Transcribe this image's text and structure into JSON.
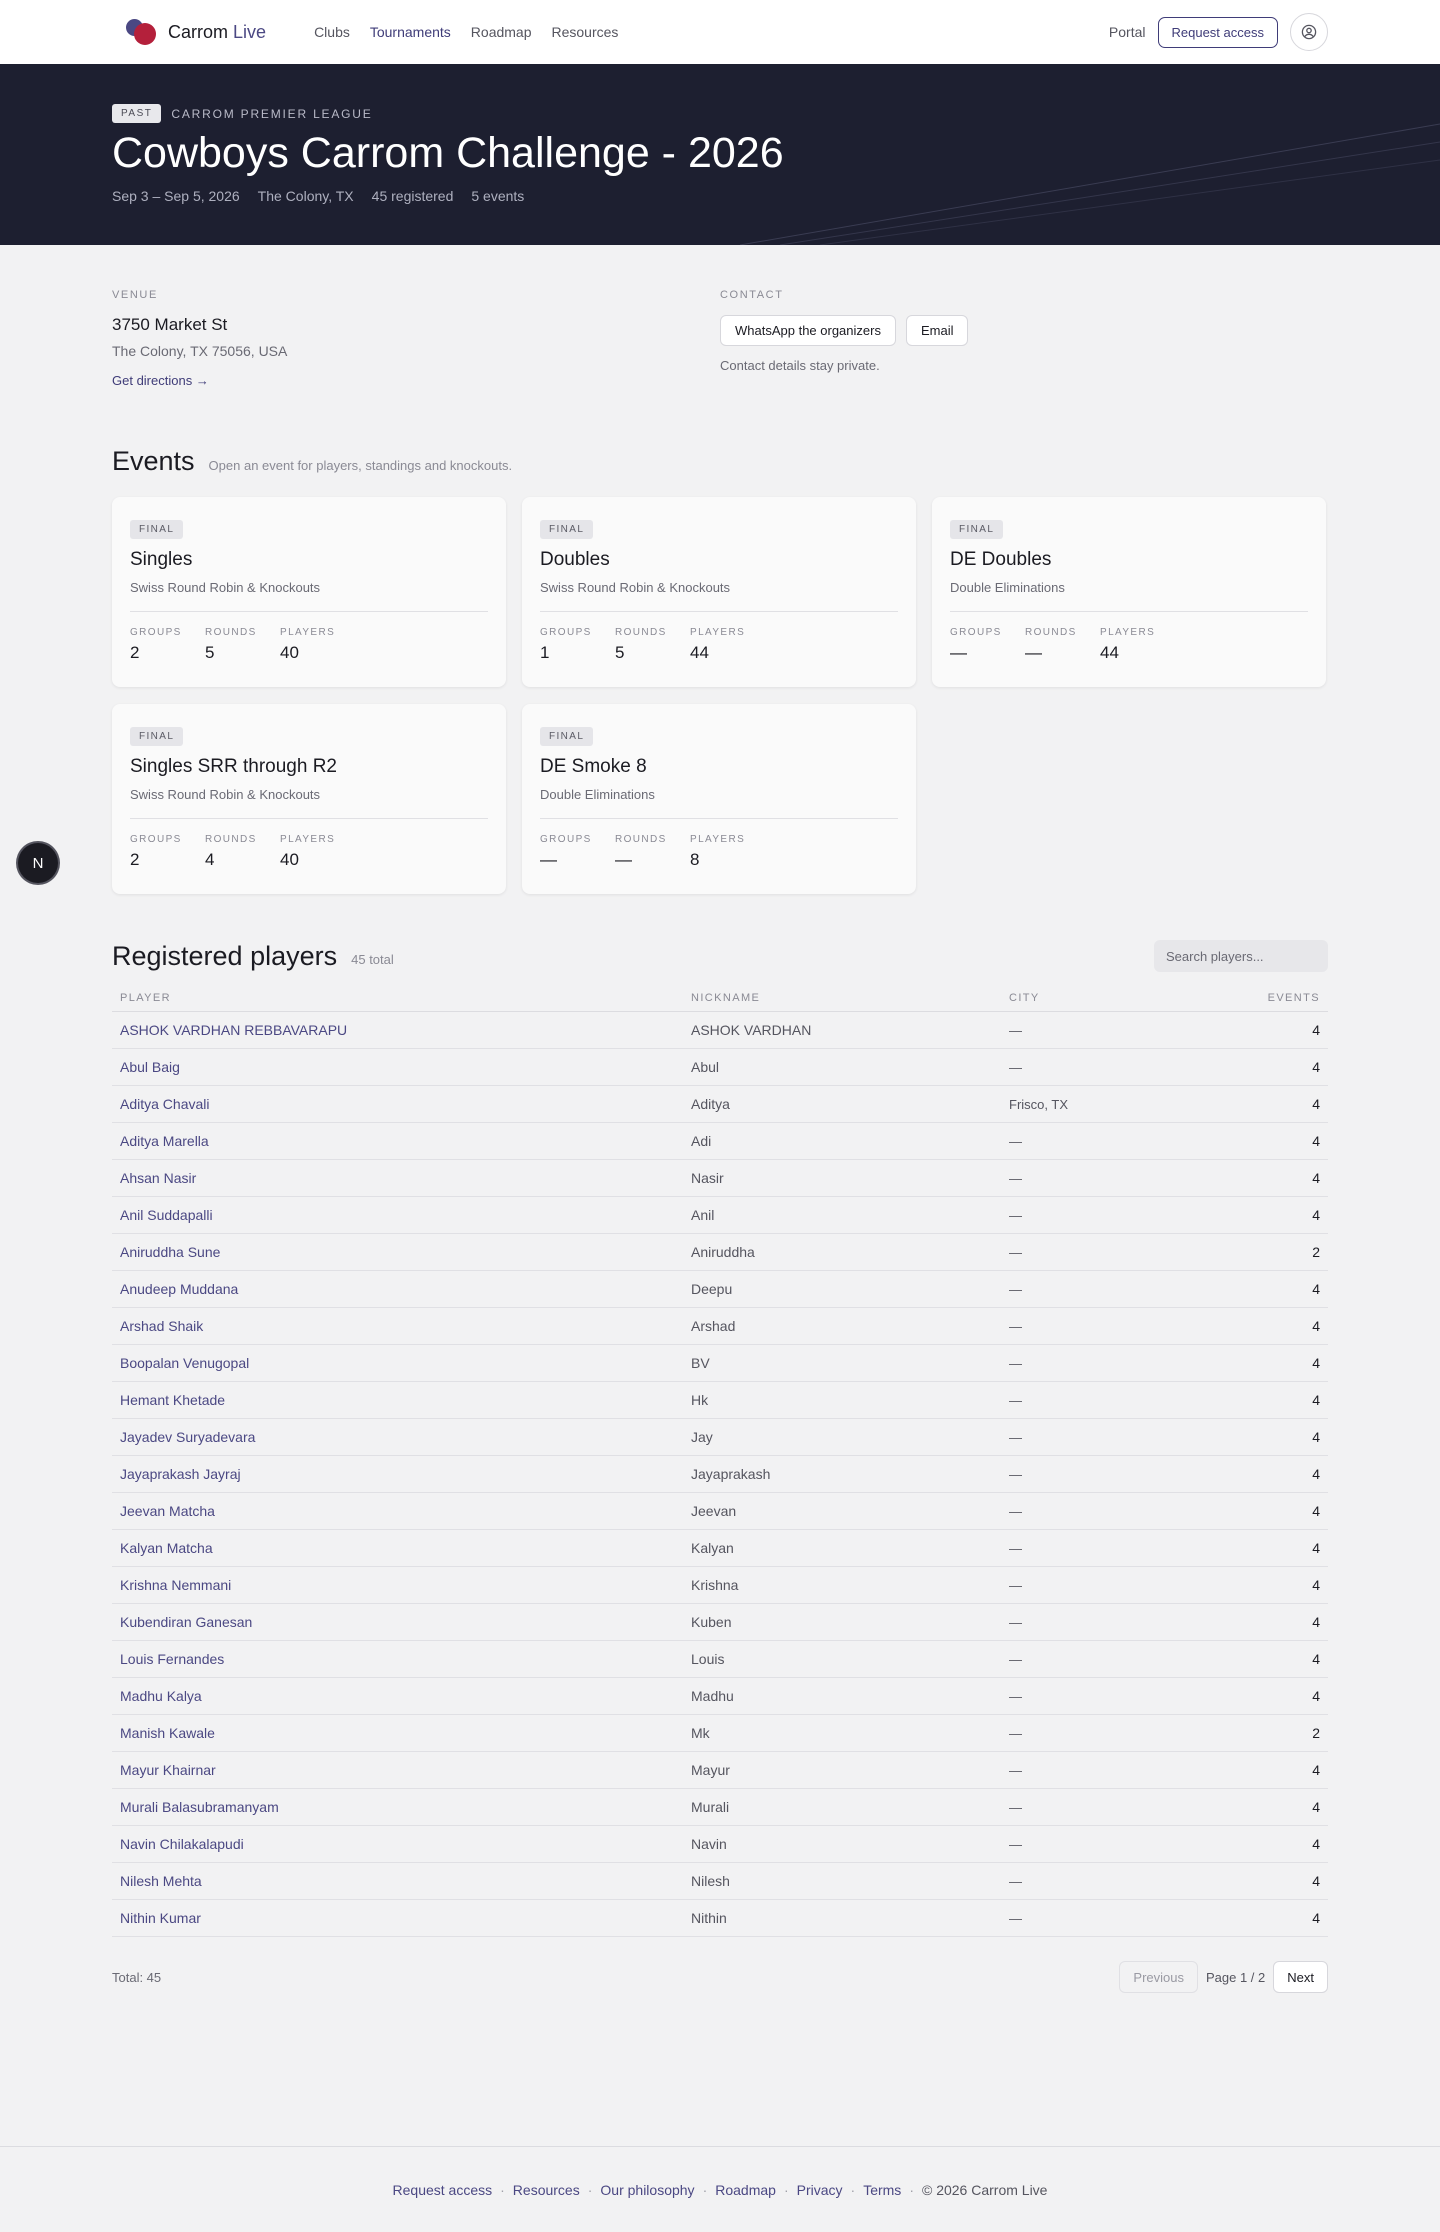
{
  "nav": {
    "brand_main": "Carrom",
    "brand_accent": "Live",
    "links": [
      {
        "label": "Clubs",
        "active": false
      },
      {
        "label": "Tournaments",
        "active": true
      },
      {
        "label": "Roadmap",
        "active": false
      },
      {
        "label": "Resources",
        "active": false
      }
    ],
    "portal": "Portal",
    "request_access": "Request access"
  },
  "hero": {
    "badge": "PAST",
    "league": "CARROM PREMIER LEAGUE",
    "title": "Cowboys Carrom Challenge - 2026",
    "dates": "Sep 3 – Sep 5, 2026",
    "location": "The Colony, TX",
    "registered": "45 registered",
    "events": "5 events"
  },
  "venue": {
    "label": "VENUE",
    "name": "3750 Market St",
    "address": "The Colony, TX 75056, USA",
    "directions": "Get directions →"
  },
  "contact": {
    "label": "CONTACT",
    "whatsapp": "WhatsApp the organizers",
    "email": "Email",
    "note": "Contact details stay private."
  },
  "events_section": {
    "title": "Events",
    "subtitle": "Open an event for players, standings and knockouts.",
    "stat_labels": {
      "groups": "GROUPS",
      "rounds": "ROUNDS",
      "players": "PLAYERS"
    },
    "cards": [
      {
        "badge": "FINAL",
        "name": "Singles",
        "format": "Swiss Round Robin & Knockouts",
        "groups": "2",
        "rounds": "5",
        "players": "40"
      },
      {
        "badge": "FINAL",
        "name": "Doubles",
        "format": "Swiss Round Robin & Knockouts",
        "groups": "1",
        "rounds": "5",
        "players": "44"
      },
      {
        "badge": "FINAL",
        "name": "DE Doubles",
        "format": "Double Eliminations",
        "groups": "—",
        "rounds": "—",
        "players": "44"
      },
      {
        "badge": "FINAL",
        "name": "Singles SRR through R2",
        "format": "Swiss Round Robin & Knockouts",
        "groups": "2",
        "rounds": "4",
        "players": "40"
      },
      {
        "badge": "FINAL",
        "name": "DE Smoke 8",
        "format": "Double Eliminations",
        "groups": "—",
        "rounds": "—",
        "players": "8"
      }
    ]
  },
  "players_section": {
    "title": "Registered players",
    "count": "45 total",
    "search_placeholder": "Search players...",
    "columns": [
      "PLAYER",
      "NICKNAME",
      "CITY",
      "EVENTS"
    ],
    "rows": [
      [
        "ASHOK VARDHAN REBBAVARAPU",
        "ASHOK VARDHAN",
        "—",
        "4"
      ],
      [
        "Abul Baig",
        "Abul",
        "—",
        "4"
      ],
      [
        "Aditya Chavali",
        "Aditya",
        "Frisco, TX",
        "4"
      ],
      [
        "Aditya Marella",
        "Adi",
        "—",
        "4"
      ],
      [
        "Ahsan Nasir",
        "Nasir",
        "—",
        "4"
      ],
      [
        "Anil Suddapalli",
        "Anil",
        "—",
        "4"
      ],
      [
        "Aniruddha Sune",
        "Aniruddha",
        "—",
        "2"
      ],
      [
        "Anudeep Muddana",
        "Deepu",
        "—",
        "4"
      ],
      [
        "Arshad Shaik",
        "Arshad",
        "—",
        "4"
      ],
      [
        "Boopalan Venugopal",
        "BV",
        "—",
        "4"
      ],
      [
        "Hemant Khetade",
        "Hk",
        "—",
        "4"
      ],
      [
        "Jayadev Suryadevara",
        "Jay",
        "—",
        "4"
      ],
      [
        "Jayaprakash Jayraj",
        "Jayaprakash",
        "—",
        "4"
      ],
      [
        "Jeevan Matcha",
        "Jeevan",
        "—",
        "4"
      ],
      [
        "Kalyan Matcha",
        "Kalyan",
        "—",
        "4"
      ],
      [
        "Krishna Nemmani",
        "Krishna",
        "—",
        "4"
      ],
      [
        "Kubendiran Ganesan",
        "Kuben",
        "—",
        "4"
      ],
      [
        "Louis Fernandes",
        "Louis",
        "—",
        "4"
      ],
      [
        "Madhu Kalya",
        "Madhu",
        "—",
        "4"
      ],
      [
        "Manish Kawale",
        "Mk",
        "—",
        "2"
      ],
      [
        "Mayur Khairnar",
        "Mayur",
        "—",
        "4"
      ],
      [
        "Murali Balasubramanyam",
        "Murali",
        "—",
        "4"
      ],
      [
        "Navin Chilakalapudi",
        "Navin",
        "—",
        "4"
      ],
      [
        "Nilesh Mehta",
        "Nilesh",
        "—",
        "4"
      ],
      [
        "Nithin Kumar",
        "Nithin",
        "—",
        "4"
      ]
    ],
    "total": "Total: 45",
    "previous": "Previous",
    "page_info": "Page 1 / 2",
    "next": "Next"
  },
  "footer": {
    "links": [
      "Request access",
      "Resources",
      "Our philosophy",
      "Roadmap",
      "Privacy",
      "Terms"
    ],
    "copyright": "© 2026 Carrom Live"
  },
  "floating_badge": "N",
  "icons": {
    "account": "user-circle-icon",
    "logo": "carrom-live-logo"
  },
  "colors": {
    "accent": "#3f3c78",
    "brand_red": "#b4203b",
    "hero_bg": "#1d1f30"
  }
}
